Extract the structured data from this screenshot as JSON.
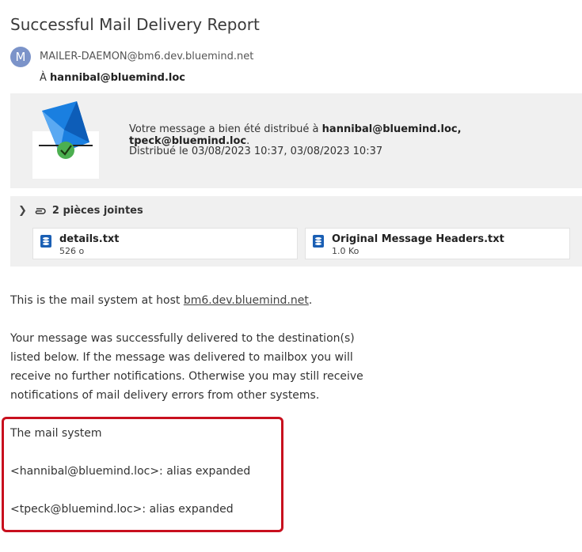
{
  "message": {
    "subject": "Successful Mail Delivery Report",
    "avatar_initial": "M",
    "from": "MAILER-DAEMON@bm6.dev.bluemind.net",
    "to_prefix": "À",
    "to": "hannibal@bluemind.loc"
  },
  "report": {
    "delivered_prefix": "Votre message a bien été distribué à",
    "delivered_recipients": "hannibal@bluemind.loc, tpeck@bluemind.loc",
    "delivered_suffix": ".",
    "delivered_date": "Distribué le 03/08/2023 10:37, 03/08/2023 10:37"
  },
  "attachments": {
    "label": "2 pièces jointes",
    "items": [
      {
        "name": "details.txt",
        "size": "526 o"
      },
      {
        "name": "Original Message Headers.txt",
        "size": "1.0 Ko"
      }
    ]
  },
  "body": {
    "p1_prefix": "This is the mail system at host",
    "p1_link": "bm6.dev.bluemind.net",
    "p1_suffix": ".",
    "p2": "Your message was successfully delivered to the destination(s) listed below. If the message was delivered to mailbox you will receive no further notifications. Otherwise you may still receive notifications of mail delivery errors from other systems.",
    "p3": "The mail system",
    "p4": "<hannibal@bluemind.loc>: alias expanded",
    "p5": "<tpeck@bluemind.loc>: alias expanded"
  },
  "colors": {
    "highlight_border": "#c8101e",
    "envelope_blue": "#1a7fe0",
    "check_green": "#4caf50"
  }
}
